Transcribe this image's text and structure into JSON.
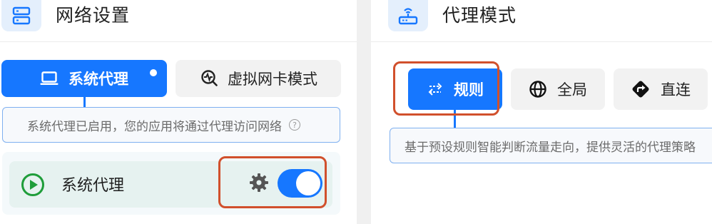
{
  "left_panel": {
    "title": "网络设置",
    "icon": "server-icon",
    "modes": [
      {
        "label": "系统代理",
        "icon": "laptop-icon",
        "active": true
      },
      {
        "label": "虚拟网卡模式",
        "icon": "search-wave-icon",
        "active": false
      }
    ],
    "description": "系统代理已启用，您的应用将通过代理访问网络",
    "help_icon": "?",
    "proxy_toggle": {
      "label": "系统代理",
      "icon": "play-circle-icon",
      "settings_icon": "gear-icon",
      "enabled": true
    }
  },
  "right_panel": {
    "title": "代理模式",
    "icon": "router-icon",
    "modes": [
      {
        "label": "规则",
        "icon": "arrows-swap-icon",
        "active": true
      },
      {
        "label": "全局",
        "icon": "globe-icon",
        "active": false
      },
      {
        "label": "直连",
        "icon": "direction-arrow-icon",
        "active": false
      }
    ],
    "description": "基于预设规则智能判断流量走向，提供灵活的代理策略"
  },
  "colors": {
    "accent": "#1677ff",
    "highlight": "#d1502c",
    "play_green": "#1f9d3a"
  }
}
